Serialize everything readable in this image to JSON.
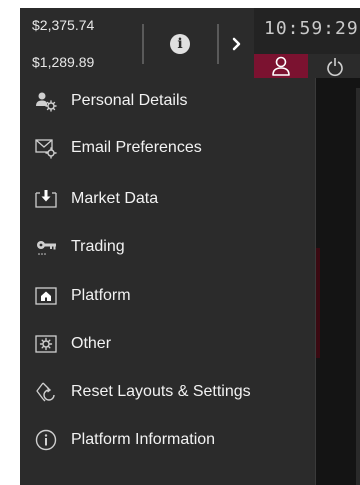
{
  "header": {
    "balance_primary": "$2,375.74",
    "balance_secondary": "$1,289.89",
    "clock": "10:59:29",
    "info_glyph": "i",
    "accent_color": "#7b1230"
  },
  "menu": {
    "items": [
      {
        "label": "Personal Details",
        "icon": "person-gear-icon"
      },
      {
        "label": "Email Preferences",
        "icon": "envelope-gear-icon"
      },
      {
        "label": "Market Data",
        "icon": "download-tray-icon"
      },
      {
        "label": "Trading",
        "icon": "key-icon"
      },
      {
        "label": "Platform",
        "icon": "home-icon"
      },
      {
        "label": "Other",
        "icon": "gear-box-icon"
      },
      {
        "label": "Reset Layouts & Settings",
        "icon": "reset-icon"
      },
      {
        "label": "Platform Information",
        "icon": "info-circle-icon"
      }
    ]
  }
}
